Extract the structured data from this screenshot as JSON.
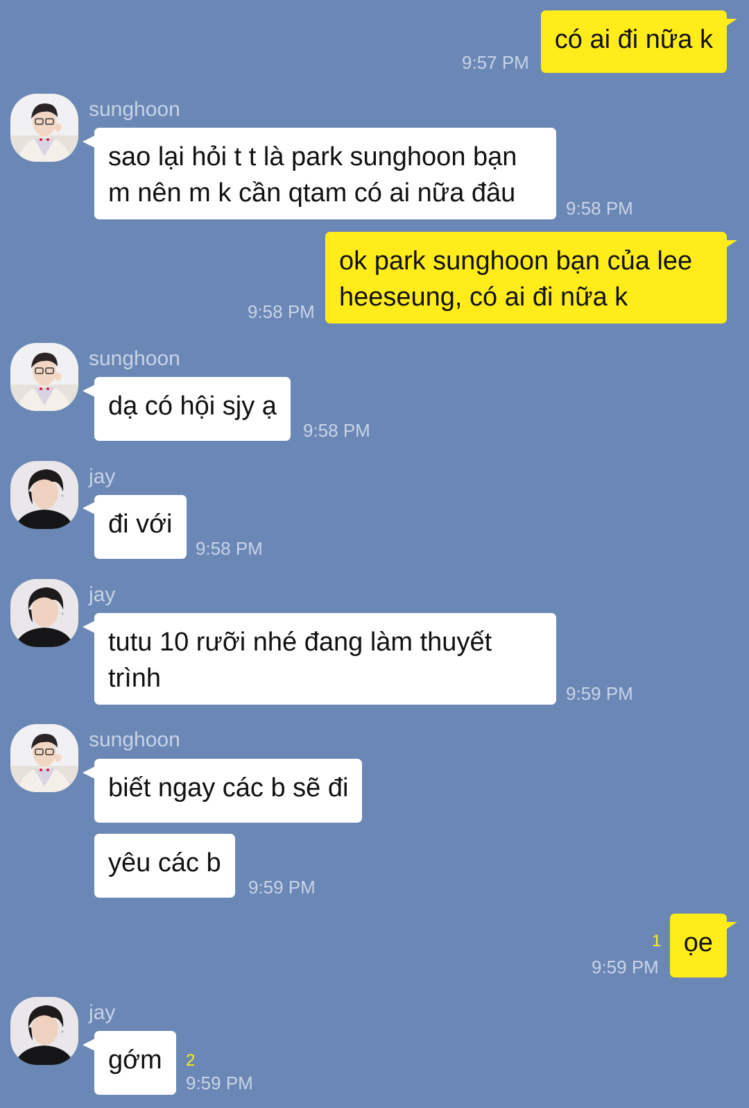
{
  "messages": [
    {
      "text": "có ai đi nữa k",
      "time": "9:57 PM"
    },
    {
      "sender": "sunghoon",
      "text": "sao lại hỏi t t là park sunghoon bạn\nm nên m k cần qtam có ai nữa đâu",
      "time": "9:58 PM"
    },
    {
      "text": "ok park sunghoon bạn của lee\nheeseung, có ai đi nữa k",
      "time": "9:58 PM"
    },
    {
      "sender": "sunghoon",
      "text": "dạ có hội sjy ạ",
      "time": "9:58 PM"
    },
    {
      "sender": "jay",
      "text": "đi với",
      "time": "9:58 PM"
    },
    {
      "sender": "jay",
      "text": "tutu 10 rưỡi nhé đang làm thuyết\ntrình",
      "time": "9:59 PM"
    },
    {
      "sender": "sunghoon",
      "text": "biết ngay các b sẽ đi"
    },
    {
      "text": "yêu các b",
      "time": "9:59 PM"
    },
    {
      "text": "ọe",
      "time": "9:59 PM",
      "unread": "1"
    },
    {
      "sender": "jay",
      "text": "gớm",
      "time": "9:59 PM",
      "unread": "2"
    }
  ],
  "colors": {
    "background": "#6a87b5",
    "outgoing_bubble": "#ffec1a",
    "incoming_bubble": "#ffffff",
    "timestamp": "#c9d4e8",
    "unread_count": "#ffec1a"
  },
  "avatars": {
    "sunghoon": "avatar-sunghoon",
    "jay": "avatar-jay"
  }
}
